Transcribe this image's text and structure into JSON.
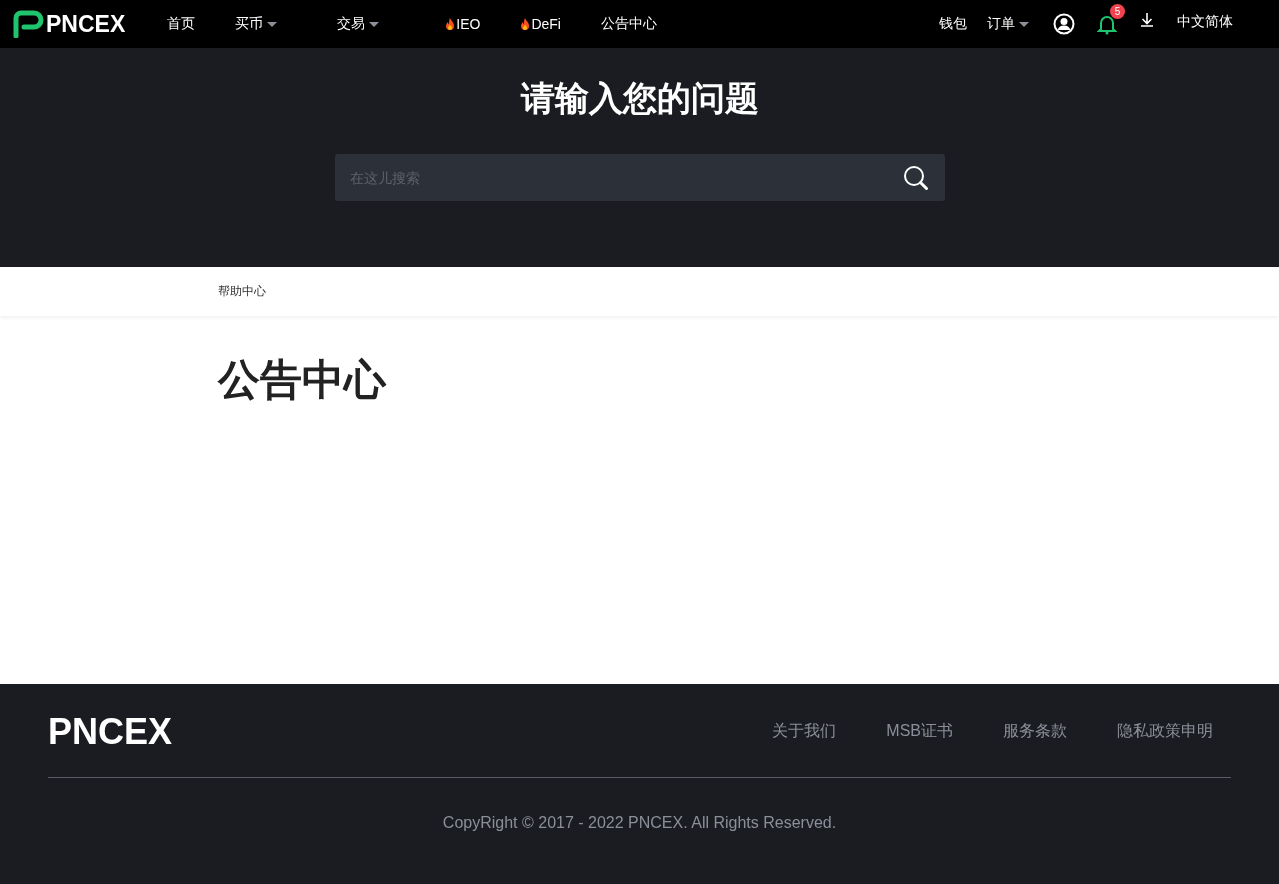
{
  "header": {
    "logo": "PNCEX",
    "nav": [
      {
        "label": "首页",
        "kind": "plain"
      },
      {
        "label": "买币",
        "kind": "dropdown"
      },
      {
        "label": "交易",
        "kind": "dropdown"
      },
      {
        "label": "IEO",
        "kind": "hot"
      },
      {
        "label": "DeFi",
        "kind": "hot"
      },
      {
        "label": "公告中心",
        "kind": "plain"
      }
    ],
    "wallet": "钱包",
    "orders": "订单",
    "notification_count": "5",
    "language": "中文简体"
  },
  "hero": {
    "title": "请输入您的问题",
    "search": {
      "placeholder": "在这儿搜索"
    }
  },
  "breadcrumb": "帮助中心",
  "page_title": "公告中心",
  "footer": {
    "logo": "PNCEX",
    "links": [
      "关于我们",
      "MSB证书",
      "服务条款",
      "隐私政策申明"
    ],
    "copyright": "CopyRight © 2017 - 2022 PNCEX. All Rights Reserved."
  }
}
